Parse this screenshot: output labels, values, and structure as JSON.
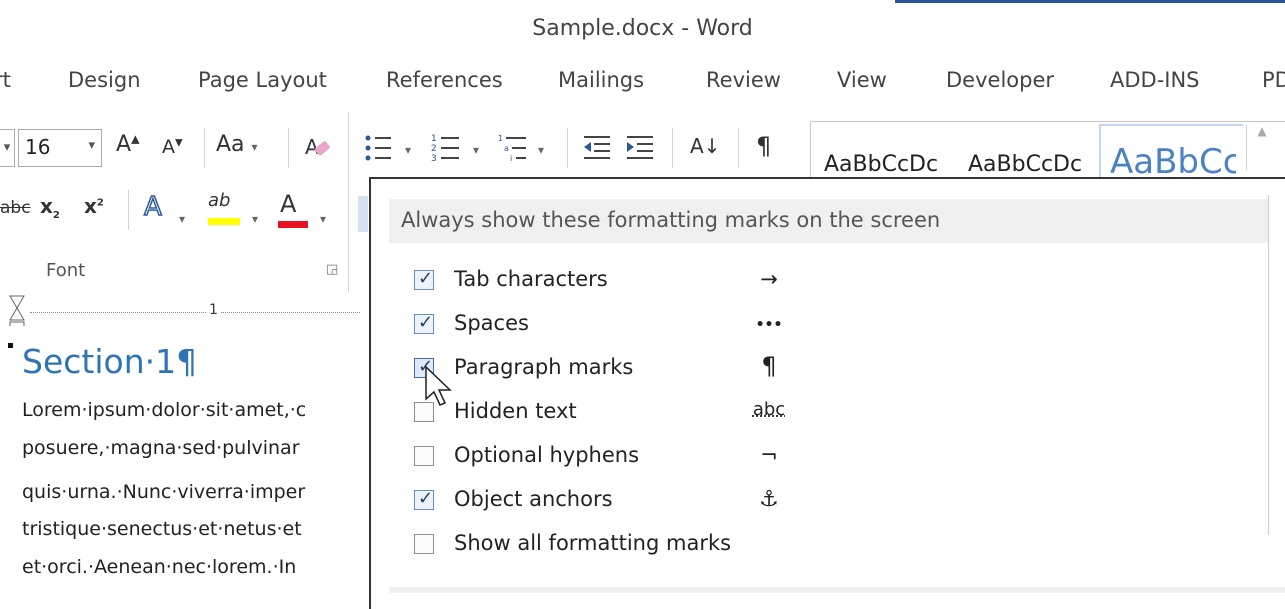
{
  "window": {
    "title": "Sample.docx - Word"
  },
  "tabs": [
    "rt",
    "Design",
    "Page Layout",
    "References",
    "Mailings",
    "Review",
    "View",
    "Developer",
    "ADD-INS",
    "PD"
  ],
  "ribbon": {
    "font_size": "16",
    "grow_font": "A",
    "shrink_font": "A",
    "change_case": "Aa",
    "strikethrough": "abc",
    "subscript": "x",
    "superscript": "x",
    "text_effects": "A",
    "highlight": "ab",
    "font_color": "A",
    "sort": "A↓",
    "pilcrow": "¶",
    "font_group_label": "Font",
    "styles": [
      "AaBbCcDc",
      "AaBbCcDc",
      "AaBbCc"
    ]
  },
  "ruler": {
    "marker": "1"
  },
  "document": {
    "heading": "Section·1¶",
    "lines": [
      "Lorem·ipsum·dolor·sit·amet,·c",
      "posuere,·magna·sed·pulvinar",
      "quis·urna.·Nunc·viverra·imper",
      "tristique·senectus·et·netus·et",
      "et·orci.·Aenean·nec·lorem.·In"
    ]
  },
  "panel": {
    "heading": "Always show these formatting marks on the screen",
    "options": [
      {
        "label": "Tab characters",
        "symbol": "→",
        "checked": true
      },
      {
        "label": "Spaces",
        "symbol": "•••",
        "checked": true
      },
      {
        "label": "Paragraph marks",
        "symbol": "¶",
        "checked": true
      },
      {
        "label": "Hidden text",
        "symbol": "abc",
        "checked": false
      },
      {
        "label": "Optional hyphens",
        "symbol": "¬",
        "checked": false
      },
      {
        "label": "Object anchors",
        "symbol": "⚓",
        "checked": true
      },
      {
        "label": "Show all formatting marks",
        "symbol": "",
        "checked": false
      }
    ]
  },
  "colors": {
    "accent": "#2b579a",
    "heading_blue": "#2e74b5",
    "highlight_yellow": "#ffff00",
    "font_red": "#e81123"
  }
}
